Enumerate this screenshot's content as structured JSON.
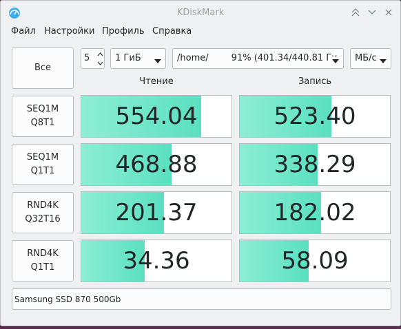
{
  "window": {
    "title": "KDiskMark"
  },
  "menu": [
    "Файл",
    "Настройки",
    "Профиль",
    "Справка"
  ],
  "controls": {
    "all_label": "Все",
    "loops": "5",
    "size": "1 ГиБ",
    "target": "/home/        91% (401.34/440.81 Ги",
    "unit": "МБ/с"
  },
  "columns": {
    "read": "Чтение",
    "write": "Запись"
  },
  "tests": [
    {
      "name_line1": "SEQ1M",
      "name_line2": "Q8T1",
      "read": "554.04",
      "write": "523.40",
      "read_fill": 0.8,
      "write_fill": 0.61
    },
    {
      "name_line1": "SEQ1M",
      "name_line2": "Q1T1",
      "read": "468.88",
      "write": "338.29",
      "read_fill": 0.6,
      "write_fill": 0.52
    },
    {
      "name_line1": "RND4K",
      "name_line2": "Q32T16",
      "read": "201.37",
      "write": "182.02",
      "read_fill": 0.55,
      "write_fill": 0.54
    },
    {
      "name_line1": "RND4K",
      "name_line2": "Q1T1",
      "read": "34.36",
      "write": "58.09",
      "read_fill": 0.42,
      "write_fill": 0.46
    }
  ],
  "comment": "Samsung SSD 870 500Gb",
  "colors": {
    "fill": "#5ae0c0",
    "window_bg": "#eff0f1"
  }
}
